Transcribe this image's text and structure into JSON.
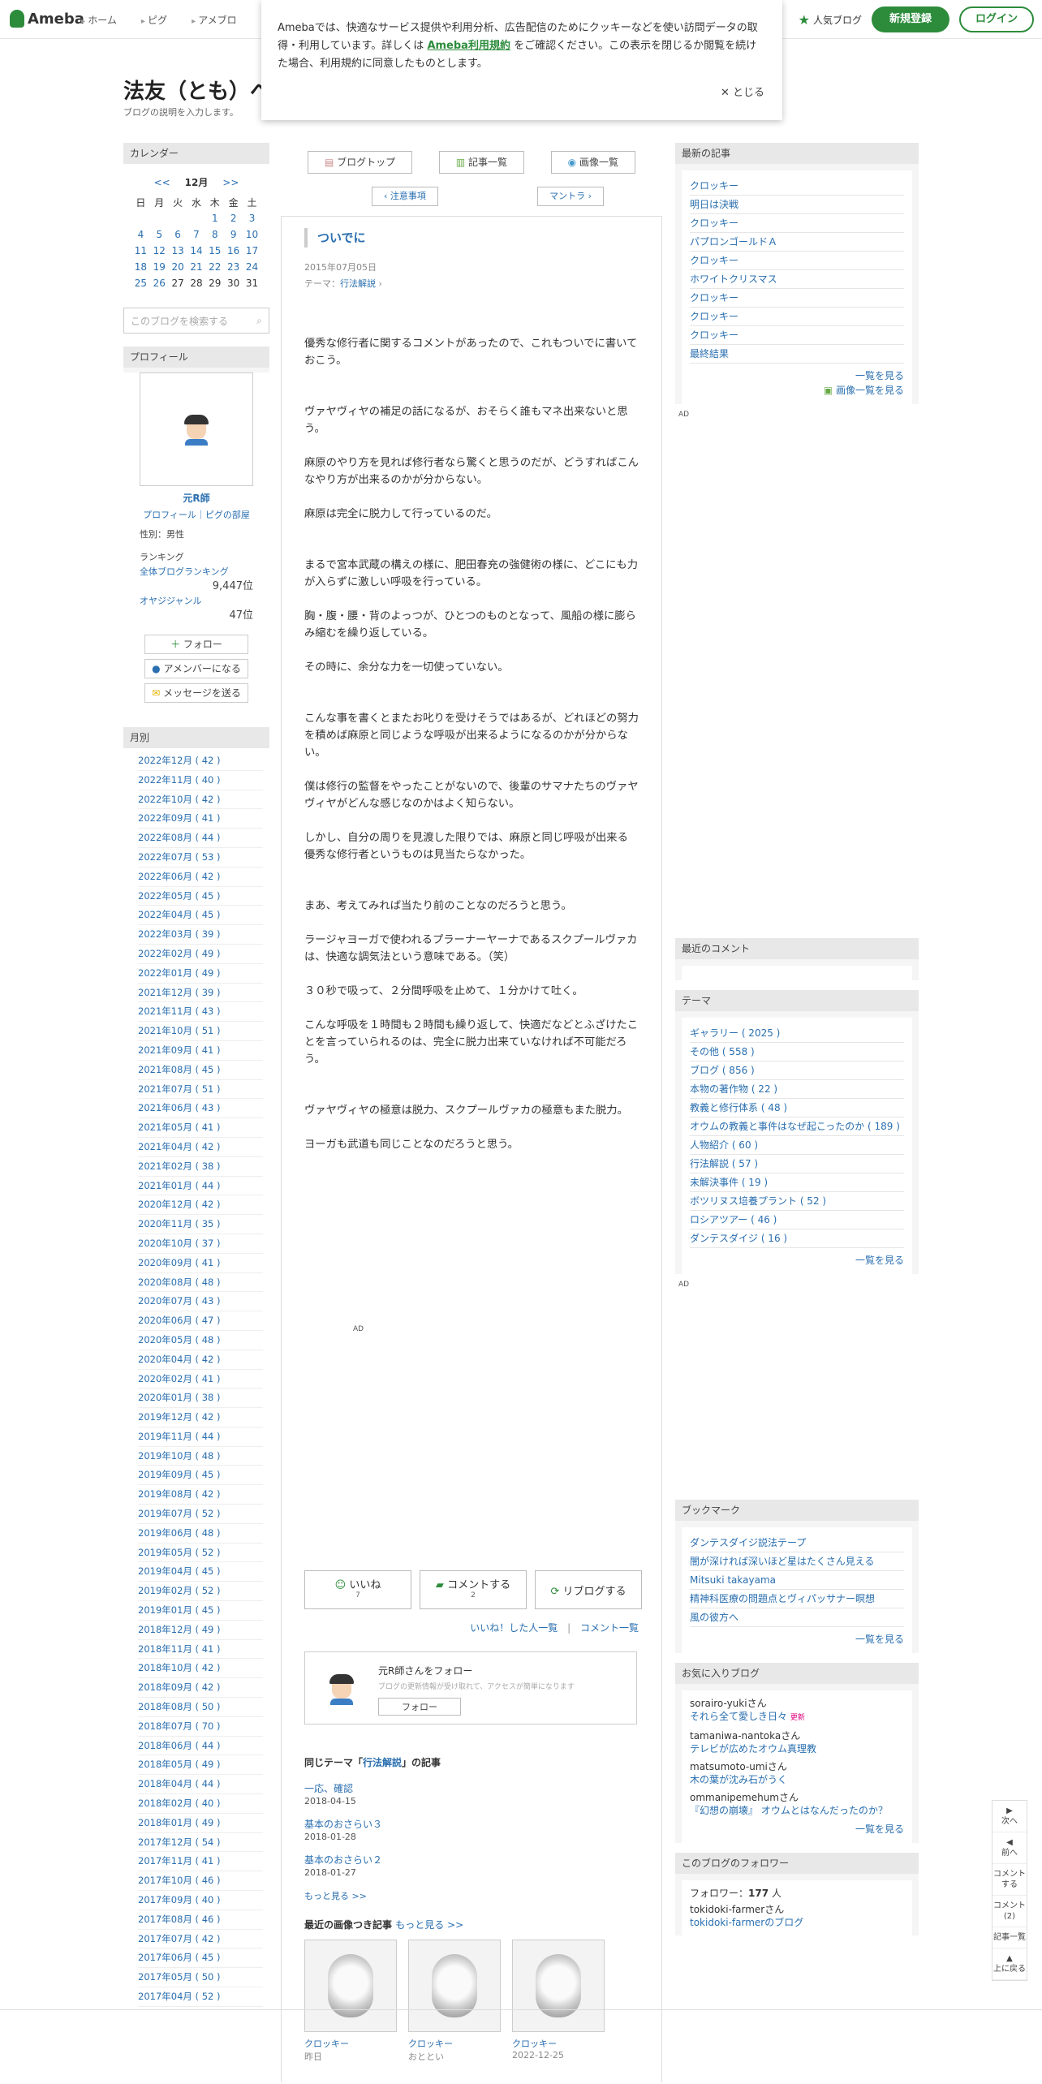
{
  "header": {
    "logo": "Ameba",
    "nav": [
      "ホーム",
      "ピグ",
      "アメブロ"
    ],
    "popular": "人気ブログ",
    "register": "新規登録",
    "login": "ログイン"
  },
  "cookie": {
    "text1": "Amebaでは、快適なサービス提供や利用分析、広告配信のためにクッキーなどを使い訪問データの取得・利用しています。詳しくは",
    "link": "Ameba利用規約",
    "text2": "をご確認ください。この表示を閉じるか閲覧を続けた場合、利用規約に同意したものとします。",
    "close": "とじる"
  },
  "blog": {
    "title": "法友（とも）へ",
    "desc": "ブログの説明を入力します。"
  },
  "calendar": {
    "heading": "カレンダー",
    "prev": "<<",
    "month": "12月",
    "next": ">>",
    "days": [
      "日",
      "月",
      "火",
      "水",
      "木",
      "金",
      "土"
    ],
    "weeks": [
      [
        "",
        "",
        "",
        "",
        "1",
        "2",
        "3"
      ],
      [
        "4",
        "5",
        "6",
        "7",
        "8",
        "9",
        "10"
      ],
      [
        "11",
        "12",
        "13",
        "14",
        "15",
        "16",
        "17"
      ],
      [
        "18",
        "19",
        "20",
        "21",
        "22",
        "23",
        "24"
      ],
      [
        "25",
        "26",
        "27",
        "28",
        "29",
        "30",
        "31"
      ]
    ]
  },
  "search": {
    "placeholder": "このブログを検索する"
  },
  "profile": {
    "heading": "プロフィール",
    "name": "元R師",
    "links": "プロフィール｜ピグの部屋",
    "gender": "性別：男性",
    "ranking": "ランキング",
    "rank_all": "全体ブログランキング",
    "rank_all_val": "9,447位",
    "rank_genre": "オヤジジャンル",
    "rank_genre_val": "47位",
    "follow": "フォロー",
    "member": "アメンバーになる",
    "message": "メッセージを送る"
  },
  "monthly": {
    "heading": "月別",
    "items": [
      "2022年12月 ( 42 )",
      "2022年11月 ( 40 )",
      "2022年10月 ( 42 )",
      "2022年09月 ( 41 )",
      "2022年08月 ( 44 )",
      "2022年07月 ( 53 )",
      "2022年06月 ( 42 )",
      "2022年05月 ( 45 )",
      "2022年04月 ( 45 )",
      "2022年03月 ( 39 )",
      "2022年02月 ( 49 )",
      "2022年01月 ( 49 )",
      "2021年12月 ( 39 )",
      "2021年11月 ( 43 )",
      "2021年10月 ( 51 )",
      "2021年09月 ( 41 )",
      "2021年08月 ( 45 )",
      "2021年07月 ( 51 )",
      "2021年06月 ( 43 )",
      "2021年05月 ( 41 )",
      "2021年04月 ( 42 )",
      "2021年02月 ( 38 )",
      "2021年01月 ( 44 )",
      "2020年12月 ( 42 )",
      "2020年11月 ( 35 )",
      "2020年10月 ( 37 )",
      "2020年09月 ( 41 )",
      "2020年08月 ( 48 )",
      "2020年07月 ( 43 )",
      "2020年06月 ( 47 )",
      "2020年05月 ( 48 )",
      "2020年04月 ( 42 )",
      "2020年02月 ( 41 )",
      "2020年01月 ( 38 )",
      "2019年12月 ( 42 )",
      "2019年11月 ( 44 )",
      "2019年10月 ( 48 )",
      "2019年09月 ( 45 )",
      "2019年08月 ( 42 )",
      "2019年07月 ( 52 )",
      "2019年06月 ( 48 )",
      "2019年05月 ( 52 )",
      "2019年04月 ( 45 )",
      "2019年02月 ( 52 )",
      "2019年01月 ( 45 )",
      "2018年12月 ( 49 )",
      "2018年11月 ( 41 )",
      "2018年10月 ( 42 )",
      "2018年09月 ( 42 )",
      "2018年08月 ( 50 )",
      "2018年07月 ( 70 )",
      "2018年06月 ( 44 )",
      "2018年05月 ( 49 )",
      "2018年04月 ( 44 )",
      "2018年02月 ( 40 )",
      "2018年01月 ( 49 )",
      "2017年12月 ( 54 )",
      "2017年11月 ( 41 )",
      "2017年10月 ( 46 )",
      "2017年09月 ( 40 )",
      "2017年08月 ( 46 )",
      "2017年07月 ( 42 )",
      "2017年06月 ( 45 )",
      "2017年05月 ( 50 )",
      "2017年04月 ( 52 )"
    ]
  },
  "tabs": {
    "top": "ブログトップ",
    "list": "記事一覧",
    "images": "画像一覧"
  },
  "pager": {
    "prev": "注意事項",
    "next": "マントラ"
  },
  "article": {
    "title": "ついでに",
    "date": "2015年07月05日",
    "theme_label": "テーマ：",
    "theme": "行法解説",
    "body": [
      "優秀な修行者に関するコメントがあったので、これもついでに書いておこう。",
      "",
      "",
      "ヴァヤヴィヤの補足の話になるが、おそらく誰もマネ出来ないと思う。",
      "",
      "麻原のやり方を見れば修行者なら驚くと思うのだが、どうすればこんなやり方が出来るのかが分からない。",
      "",
      "麻原は完全に脱力して行っているのだ。",
      "",
      "",
      "まるで宮本武蔵の構えの様に、肥田春充の強健術の様に、どこにも力が入らずに激しい呼吸を行っている。",
      "",
      "胸・腹・腰・背のよっつが、ひとつのものとなって、風船の様に膨らみ縮むを繰り返している。",
      "",
      "その時に、余分な力を一切使っていない。",
      "",
      "",
      "こんな事を書くとまたお叱りを受けそうではあるが、どれほどの努力を積めば麻原と同じような呼吸が出来るようになるのかが分からない。",
      "",
      "僕は修行の監督をやったことがないので、後輩のサマナたちのヴァヤヴィヤがどんな感じなのかはよく知らない。",
      "",
      "しかし、自分の周りを見渡した限りでは、麻原と同じ呼吸が出来る優秀な修行者というものは見当たらなかった。",
      "",
      "",
      "まあ、考えてみれば当たり前のことなのだろうと思う。",
      "",
      "ラージャヨーガで使われるプラーナーヤーナであるスクプールヴァカは、快適な調気法という意味である。（笑）",
      "",
      "３０秒で吸って、２分間呼吸を止めて、１分かけて吐く。",
      "",
      "こんな呼吸を１時間も２時間も繰り返して、快適だなどとふざけたことを言っていられるのは、完全に脱力出来ていなければ不可能だろう。",
      "",
      "",
      "ヴァヤヴィヤの極意は脱力、スクプールヴァカの極意もまた脱力。",
      "",
      "ヨーガも武道も同じことなのだろうと思う。"
    ]
  },
  "ad": "AD",
  "actions": {
    "like": "いいね",
    "like_count": "7",
    "comment": "コメントする",
    "comment_count": "2",
    "reblog": "リブログする",
    "liked_users": "いいね！した人一覧",
    "comments_list": "コメント一覧"
  },
  "followbox": {
    "text": "元R師さんをフォロー",
    "sub": "ブログの更新情報が受け取れて、アクセスが簡単になります",
    "btn": "フォロー"
  },
  "same_theme": {
    "prefix": "同じテーマ「",
    "theme": "行法解説",
    "suffix": "」の記事",
    "items": [
      {
        "t": "一応、確認",
        "d": "2018-04-15"
      },
      {
        "t": "基本のおさらい３",
        "d": "2018-01-28"
      },
      {
        "t": "基本のおさらい２",
        "d": "2018-01-27"
      }
    ],
    "more": "もっと見る >>"
  },
  "recent_images": {
    "title": "最近の画像つき記事",
    "more": "もっと見る >>",
    "items": [
      {
        "t": "クロッキー",
        "d": "昨日"
      },
      {
        "t": "クロッキー",
        "d": "おととい"
      },
      {
        "t": "クロッキー",
        "d": "2022-12-25"
      }
    ]
  },
  "recent": {
    "heading": "最新の記事",
    "items": [
      "クロッキー",
      "明日は決戦",
      "クロッキー",
      "パプロンゴールドＡ",
      "クロッキー",
      "ホワイトクリスマス",
      "クロッキー",
      "クロッキー",
      "クロッキー",
      "最終結果"
    ],
    "more": "一覧を見る",
    "imgmore": "画像一覧を見る"
  },
  "recent_comments": {
    "heading": "最近のコメント"
  },
  "themes": {
    "heading": "テーマ",
    "items": [
      "ギャラリー ( 2025 )",
      "その他 ( 558 )",
      "ブログ ( 856 )",
      "本物の著作物 ( 22 )",
      "教義と修行体系 ( 48 )",
      "オウムの教義と事件はなぜ起こったのか ( 189 )",
      "人物紹介 ( 60 )",
      "行法解説 ( 57 )",
      "未解決事件 ( 19 )",
      "ボツリヌス培養プラント ( 52 )",
      "ロシアツアー ( 46 )",
      "ダンテスダイジ ( 16 )"
    ],
    "more": "一覧を見る"
  },
  "bookmarks": {
    "heading": "ブックマーク",
    "items": [
      "ダンテスダイジ説法テープ",
      "闇が深ければ深いほど星はたくさん見える",
      "Mitsuki takayama",
      "精神科医療の問題点とヴィパッサナー瞑想",
      "風の彼方へ"
    ],
    "more": "一覧を見る"
  },
  "favorites": {
    "heading": "お気に入りブログ",
    "items": [
      {
        "u": "sorairo-yuki",
        "b": "それら全て愛しき日々",
        "new": "更新"
      },
      {
        "u": "tamaniwa-nantoka",
        "b": "テレビが広めたオウム真理教",
        "new": ""
      },
      {
        "u": "matsumoto-umi",
        "b": "木の葉が沈み石がうく",
        "new": ""
      },
      {
        "u": "ommanipemehum",
        "b": "『幻想の崩壊』 オウムとはなんだったのか？",
        "new": ""
      }
    ],
    "san": "さん",
    "more": "一覧を見る"
  },
  "followers": {
    "heading": "このブログのフォロワー",
    "label": "フォロワー：",
    "count": "177",
    "unit": "人",
    "user": "tokidoki-farmer",
    "san": "さん",
    "blog": "tokidoki-farmerのブログ"
  },
  "sidenav": {
    "next": "次へ",
    "prev": "前へ",
    "comment": "コメントする",
    "comments": "コメント(2)",
    "list": "記事一覧",
    "top": "上に戻る"
  }
}
